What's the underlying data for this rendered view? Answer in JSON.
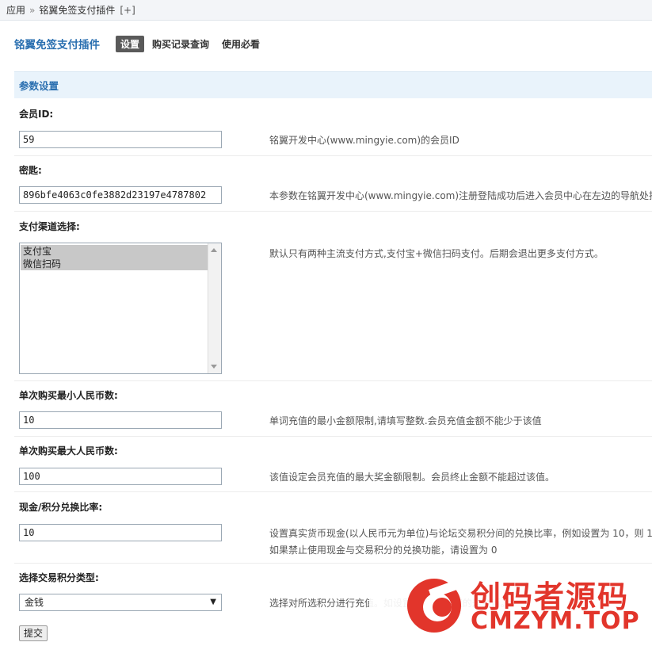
{
  "breadcrumb": {
    "root": "应用",
    "separator": "»",
    "current": "铭翼免签支付插件",
    "add": "[+]"
  },
  "plugin_title": "铭翼免签支付插件",
  "tabs": [
    {
      "label": "设置",
      "active": true
    },
    {
      "label": "购买记录查询",
      "active": false
    },
    {
      "label": "使用必看",
      "active": false
    }
  ],
  "section_title": "参数设置",
  "settings": {
    "member_id": {
      "label": "会员ID:",
      "value": "59",
      "hint": "铭翼开发中心(www.mingyie.com)的会员ID"
    },
    "secret_key": {
      "label": "密匙:",
      "value": "896bfe4063c0fe3882d23197e4787802",
      "hint": "本参数在铭翼开发中心(www.mingyie.com)注册登陆成功后进入会员中心在左边的导航处找"
    },
    "channel": {
      "label": "支付渠道选择:",
      "options": [
        "支付宝",
        "微信扫码"
      ],
      "hint": "默认只有两种主流支付方式,支付宝+微信扫码支付。后期会退出更多支付方式。"
    },
    "min_rmb": {
      "label": "单次购买最小人民币数:",
      "value": "10",
      "hint": "单词充值的最小金额限制,请填写整数.会员充值金额不能少于该值"
    },
    "max_rmb": {
      "label": "单次购买最大人民币数:",
      "value": "100",
      "hint": "该值设定会员充值的最大奖金额限制。会员终止金额不能超过该值。"
    },
    "ratio": {
      "label": "现金/积分兑换比率:",
      "value": "10",
      "hint_line1": "设置真实货币现金(以人民币元为单位)与论坛交易积分间的兑换比率，例如设置为 10，则 1",
      "hint_line2": "如果禁止使用现金与交易积分的兑换功能，请设置为 0"
    },
    "credit_type": {
      "label": "选择交易积分类型:",
      "value": "金钱",
      "hint": "选择对所选积分进行充值。如设置金币,则充值的是金币。"
    }
  },
  "submit_label": "提交",
  "watermark": {
    "cn": "创码者源码",
    "en": "CMZYM.TOP",
    "color": "#e2352b"
  }
}
